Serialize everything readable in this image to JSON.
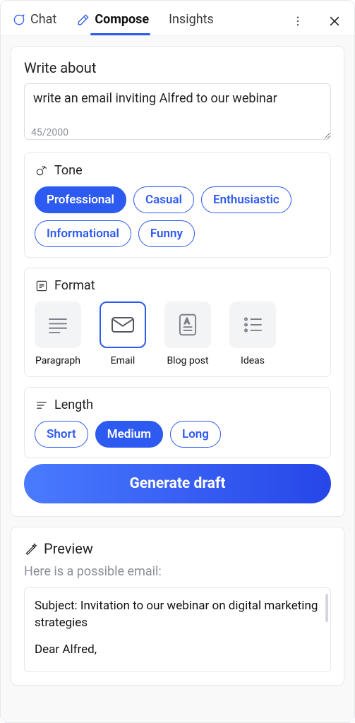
{
  "tabs": {
    "chat": "Chat",
    "compose": "Compose",
    "insights": "Insights"
  },
  "writeAbout": {
    "label": "Write about",
    "value": "write an email inviting Alfred to our webinar",
    "counter": "45/2000"
  },
  "tone": {
    "label": "Tone",
    "options": [
      "Professional",
      "Casual",
      "Enthusiastic",
      "Informational",
      "Funny"
    ],
    "selected": "Professional"
  },
  "format": {
    "label": "Format",
    "options": [
      "Paragraph",
      "Email",
      "Blog post",
      "Ideas"
    ],
    "selected": "Email"
  },
  "length": {
    "label": "Length",
    "options": [
      "Short",
      "Medium",
      "Long"
    ],
    "selected": "Medium"
  },
  "generate": "Generate draft",
  "preview": {
    "label": "Preview",
    "intro": "Here is a possible email:",
    "subject": "Subject: Invitation to our webinar on digital marketing strategies",
    "greeting": "Dear Alfred,"
  }
}
